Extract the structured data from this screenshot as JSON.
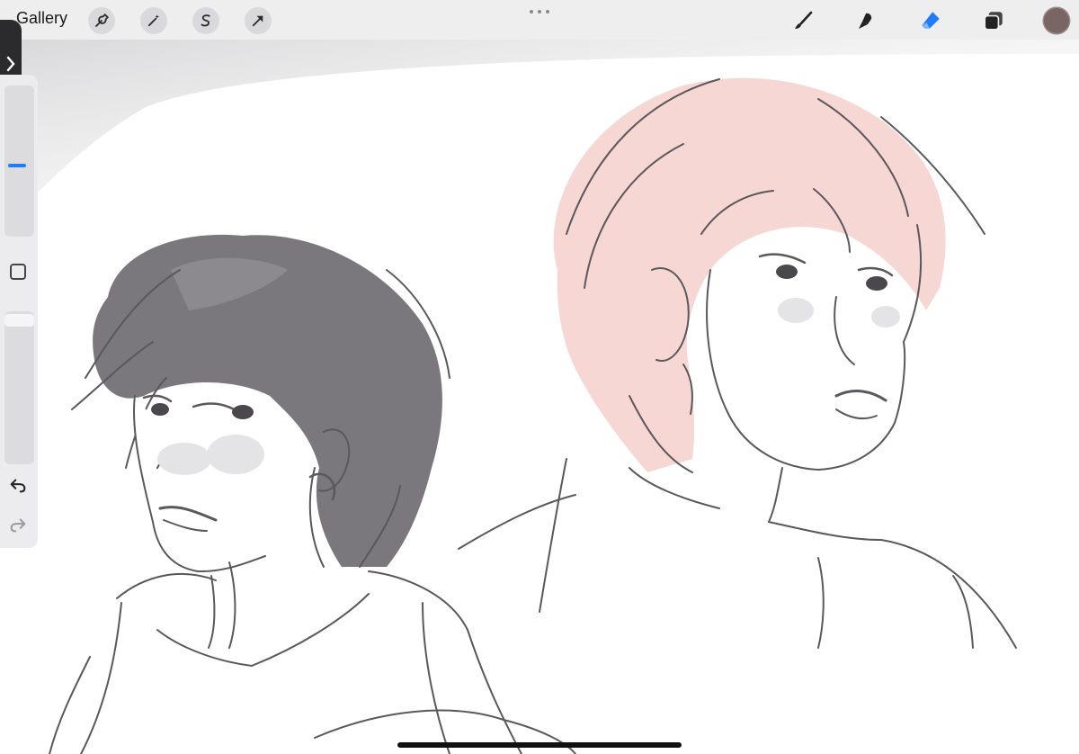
{
  "topbar": {
    "gallery_label": "Gallery",
    "left_tools": [
      "wrench-icon",
      "magic-wand-icon",
      "selection-s-icon",
      "transform-arrow-icon"
    ],
    "right_tools": [
      "brush-icon",
      "smudge-icon",
      "eraser-icon",
      "layers-icon"
    ],
    "active_tool": "eraser",
    "current_color": "#7a6565",
    "accent_color": "#1f7cff"
  },
  "sidebar": {
    "brush_size_fraction": 0.5,
    "opacity_fraction": 1.0
  },
  "canvas": {
    "hair_color_pink": "#f6d7d3",
    "line_color": "#5a585c",
    "shade_color": "#6e6c70"
  }
}
